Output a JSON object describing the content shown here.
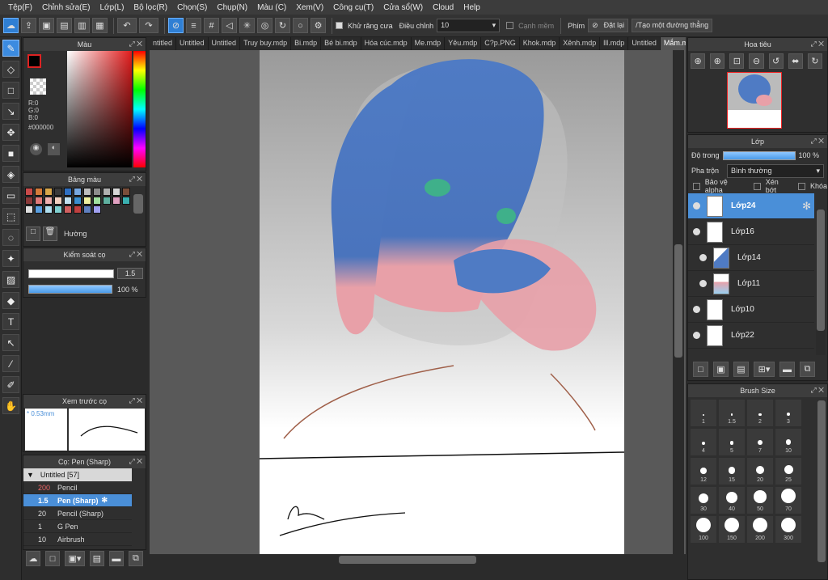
{
  "menu": [
    "Tệp(F)",
    "Chỉnh sửa(E)",
    "Lớp(L)",
    "Bộ lọc(R)",
    "Chọn(S)",
    "Chụp(N)",
    "Màu (C)",
    "Xem(V)",
    "Công cụ(T)",
    "Cửa sổ(W)",
    "Cloud",
    "Help"
  ],
  "toolbar": {
    "antialias_label": "Khử răng cưa",
    "adjust_label": "Điều chỉnh",
    "adjust_value": "10",
    "soft_edge_label": "Cạnh mềm",
    "shortcut_label": "Phím",
    "reset_label": "Đặt lại",
    "line_label": "Tạo một đường thẳng"
  },
  "tabs": [
    "ntitled",
    "Untitled",
    "Untitled",
    "Truy buy.mdp",
    "Bi.mdp",
    "Bé bi.mdp",
    "Hóa cúc.mdp",
    "Me.mdp",
    "Yêu.mdp",
    "C?p.PNG",
    "Khok.mdp",
    "Xênh.mdp",
    "lll.mdp",
    "Untitled",
    "Mắm.mdp"
  ],
  "color_panel": {
    "title": "Màu",
    "r": "R:0",
    "g": "G:0",
    "b": "B:0",
    "hex": "#000000"
  },
  "palette_panel": {
    "title": "Bảng màu",
    "label": "Hường",
    "colors": [
      "#c94a4a",
      "#d57b3a",
      "#d8a64a",
      "#3a3a3a",
      "#2e6fc2",
      "#78a8e0",
      "#bdbdbd",
      "#8c8c8c",
      "#b0b0b0",
      "#d7d7d7",
      "#7a4e3a",
      "#8a3a3a",
      "#e07a7a",
      "#f0b0b0",
      "#f2d0c0",
      "#c0e0f0",
      "#3a8fd0",
      "#f0f0a0",
      "#a0e0a0",
      "#5fb0a0",
      "#e0a0c0",
      "#3ab0b0",
      "#e0e0e0",
      "#5a9fe0",
      "#b0e0f0",
      "#80d0d0",
      "#d06060",
      "#c04040",
      "#6080c0",
      "#a0a0f0"
    ]
  },
  "brush_control": {
    "title": "Kiểm soát cọ",
    "size": "1.5",
    "opacity": "100 %"
  },
  "brush_preview": {
    "title": "Xem trước cọ",
    "size": "0.53mm"
  },
  "brush_list": {
    "title": "Cọ: Pen (Sharp)",
    "group": "Untitled [57]",
    "items": [
      {
        "size": "200",
        "name": "Pencil"
      },
      {
        "size": "1.5",
        "name": "Pen (Sharp)"
      },
      {
        "size": "20",
        "name": "Pencil (Sharp)"
      },
      {
        "size": "1",
        "name": "G Pen"
      },
      {
        "size": "10",
        "name": "Airbrush"
      }
    ]
  },
  "navigator": {
    "title": "Hoa tiêu"
  },
  "layer_panel": {
    "title": "Lớp",
    "opacity_label": "Độ trong",
    "opacity_value": "100 %",
    "blend_label": "Pha trộn",
    "blend_value": "Bình thường",
    "protect_alpha": "Bảo vệ alpha",
    "clipping": "Xén bớt",
    "lock": "Khóa",
    "layers": [
      "Lớp24",
      "Lớp16",
      "Lớp14",
      "Lớp11",
      "Lớp10",
      "Lớp22"
    ]
  },
  "brush_size": {
    "title": "Brush Size",
    "sizes": [
      "1",
      "1.5",
      "2",
      "3",
      "4",
      "5",
      "7",
      "10",
      "12",
      "15",
      "20",
      "25",
      "30",
      "40",
      "50",
      "70",
      "100",
      "150",
      "200",
      "300"
    ]
  }
}
